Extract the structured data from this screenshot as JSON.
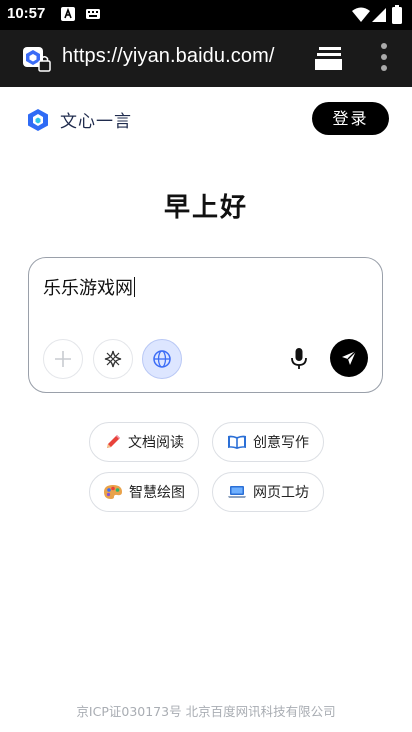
{
  "status_bar": {
    "time": "10:57"
  },
  "browser": {
    "url": "https://yiyan.baidu.com/"
  },
  "header": {
    "logo_text": "文心一言",
    "login_label": "登录"
  },
  "greeting": "早上好",
  "input": {
    "value": "乐乐游戏网"
  },
  "chips": [
    {
      "label": "文档阅读",
      "icon": "pencil-icon"
    },
    {
      "label": "创意写作",
      "icon": "book-icon"
    },
    {
      "label": "智慧绘图",
      "icon": "palette-icon"
    },
    {
      "label": "网页工坊",
      "icon": "laptop-icon"
    }
  ],
  "footer": "京ICP证030173号 北京百度网讯科技有限公司",
  "colors": {
    "accent": "#3b6cf6",
    "globe_bg": "#dde6ff",
    "browser_bar": "#1a1a1a"
  }
}
